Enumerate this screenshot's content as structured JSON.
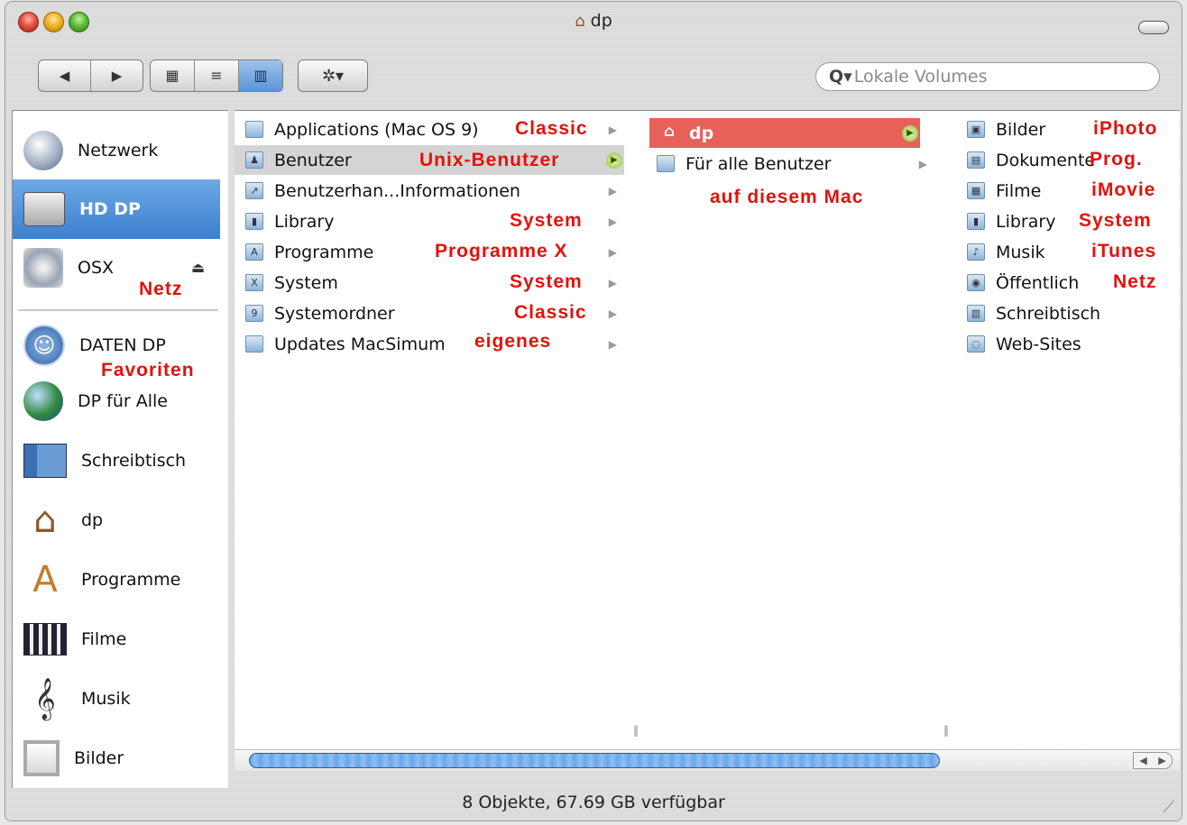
{
  "window": {
    "title": "dp",
    "status": "8 Objekte, 67.69 GB verfügbar"
  },
  "toolbar": {
    "back_label": "◀",
    "forward_label": "▶",
    "view_icon_label": "▦",
    "view_list_label": "≡",
    "view_column_label": "▥",
    "action_label": "✲▾",
    "search_placeholder": "Lokale Volumes",
    "search_icon": "Q▾"
  },
  "sidebar": {
    "items": [
      {
        "label": "Netzwerk",
        "icon": "network-globe-icon"
      },
      {
        "label": "HD DP",
        "icon": "hard-drive-icon",
        "selected": true
      },
      {
        "label": "OSX",
        "icon": "cd-disc-icon"
      },
      {
        "label": "DATEN DP",
        "icon": "universal-access-icon"
      },
      {
        "label": "DP für Alle",
        "icon": "globe-icon"
      },
      {
        "label": "Schreibtisch",
        "icon": "desktop-icon"
      },
      {
        "label": "dp",
        "icon": "home-icon"
      },
      {
        "label": "Programme",
        "icon": "applications-icon"
      },
      {
        "label": "Filme",
        "icon": "clapperboard-icon"
      },
      {
        "label": "Musik",
        "icon": "music-clef-icon"
      },
      {
        "label": "Bilder",
        "icon": "pictures-frame-icon"
      }
    ],
    "eject_label": "⏏"
  },
  "columns": {
    "col1": [
      {
        "name": "Applications (Mac OS 9)",
        "note": "Classic"
      },
      {
        "name": "Benutzer",
        "note": "Unix-Benutzer",
        "highlighted": true
      },
      {
        "name": "Benutzerhan...Informationen",
        "note": ""
      },
      {
        "name": "Library",
        "note": "System"
      },
      {
        "name": "Programme",
        "note": "Programme X"
      },
      {
        "name": "System",
        "note": "System"
      },
      {
        "name": "Systemordner",
        "note": "Classic"
      },
      {
        "name": "Updates MacSimum",
        "note": "eigenes"
      }
    ],
    "col2": [
      {
        "name": "dp",
        "selected": true
      },
      {
        "name": "Für alle Benutzer"
      }
    ],
    "col2_note": "auf diesem Mac",
    "col3": [
      {
        "name": "Bilder",
        "note": "iPhoto"
      },
      {
        "name": "Dokumente",
        "note": "Prog."
      },
      {
        "name": "Filme",
        "note": "iMovie"
      },
      {
        "name": "Library",
        "note": "System"
      },
      {
        "name": "Musik",
        "note": "iTunes"
      },
      {
        "name": "Öffentlich",
        "note": "Netz"
      },
      {
        "name": "Schreibtisch",
        "note": ""
      },
      {
        "name": "Web-Sites",
        "note": ""
      }
    ]
  },
  "annotations": {
    "osx_note": "Netz",
    "favorites_note": "Favoriten"
  },
  "colors": {
    "selection_blue": "#3b7fd0",
    "selection_red": "#e8605a",
    "annotation_red": "#e3120b"
  }
}
